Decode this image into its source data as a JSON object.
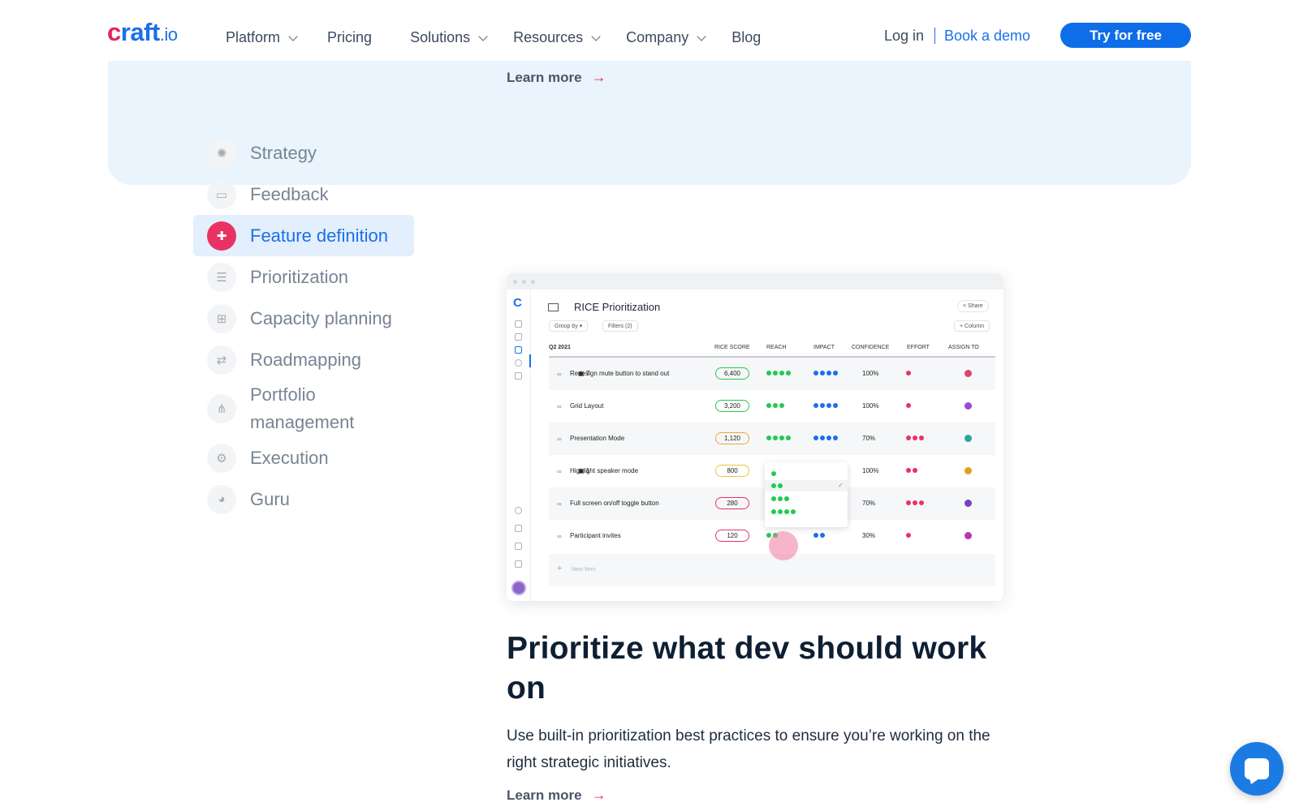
{
  "nav": {
    "logo_main": "craft",
    "logo_tld": ".io",
    "items": [
      {
        "label": "Platform",
        "has_menu": true
      },
      {
        "label": "Pricing",
        "has_menu": false
      },
      {
        "label": "Solutions",
        "has_menu": true
      },
      {
        "label": "Resources",
        "has_menu": true
      },
      {
        "label": "Company",
        "has_menu": true
      },
      {
        "label": "Blog",
        "has_menu": false
      }
    ],
    "login": "Log in",
    "demo": "Book a demo",
    "cta": "Try for free"
  },
  "band": {
    "learn_more": "Learn more"
  },
  "sidebar": {
    "items": [
      {
        "label": "Strategy",
        "icon": "lightbulb-icon"
      },
      {
        "label": "Feedback",
        "icon": "chat-icon"
      },
      {
        "label": "Feature definition",
        "icon": "puzzle-icon",
        "active": true
      },
      {
        "label": "Prioritization",
        "icon": "list-icon"
      },
      {
        "label": "Capacity planning",
        "icon": "hierarchy-icon"
      },
      {
        "label": "Roadmapping",
        "icon": "route-icon"
      },
      {
        "label": "Portfolio management",
        "icon": "tree-icon"
      },
      {
        "label": "Execution",
        "icon": "gears-icon"
      },
      {
        "label": "Guru",
        "icon": "head-icon"
      }
    ]
  },
  "app": {
    "title": "RICE Prioritization",
    "share": "Share",
    "group_by": "Group by",
    "filters": "Filters (2)",
    "column": "+ Column",
    "group": "Q2 2021",
    "headers": [
      "RICE SCORE",
      "REACH",
      "IMPACT",
      "CONFIDENCE",
      "EFFORT",
      "ASSIGN TO"
    ],
    "rows": [
      {
        "name": "Redesign mute button to stand out",
        "attach": "7",
        "score": "6,400",
        "score_color": "#1fcb4f",
        "reach": 4,
        "impact": 4,
        "confidence": "100%",
        "effort": 1,
        "avatar": "#d44a6a"
      },
      {
        "name": "Grid Layout",
        "attach": "",
        "score": "3,200",
        "score_color": "#1fcb4f",
        "reach": 3,
        "impact": 4,
        "confidence": "100%",
        "effort": 1,
        "avatar": "#9b4bd1"
      },
      {
        "name": "Presentation Mode",
        "attach": "",
        "score": "1,120",
        "score_color": "#f0a43a",
        "reach": 4,
        "impact": 4,
        "confidence": "70%",
        "effort": 3,
        "avatar": "#2aa6a0"
      },
      {
        "name": "Highlight speaker mode",
        "attach": "1",
        "score": "800",
        "score_color": "#f0c23a",
        "reach": 1,
        "impact": 0,
        "confidence": "100%",
        "effort": 2,
        "avatar": "#e0a020"
      },
      {
        "name": "Full screen on/off toggle button",
        "attach": "",
        "score": "280",
        "score_color": "#e93263",
        "reach": 0,
        "impact": 0,
        "confidence": "70%",
        "effort": 3,
        "avatar": "#7a3fc0"
      },
      {
        "name": "Participant invites",
        "attach": "",
        "score": "120",
        "score_color": "#e93263",
        "reach": 2,
        "impact": 2,
        "confidence": "30%",
        "effort": 1,
        "avatar": "#b03ab0"
      }
    ],
    "new_item": "New Item"
  },
  "content": {
    "heading": "Prioritize what dev should work on",
    "paragraph": "Use built-in prioritization best practices to ensure you’re working on the right strategic initiatives.",
    "learn_more": "Learn more"
  },
  "colors": {
    "brand_blue": "#1c6fe8",
    "brand_pink": "#e93263",
    "reach_green": "#1fcb4f",
    "impact_blue": "#1c6fe8"
  }
}
